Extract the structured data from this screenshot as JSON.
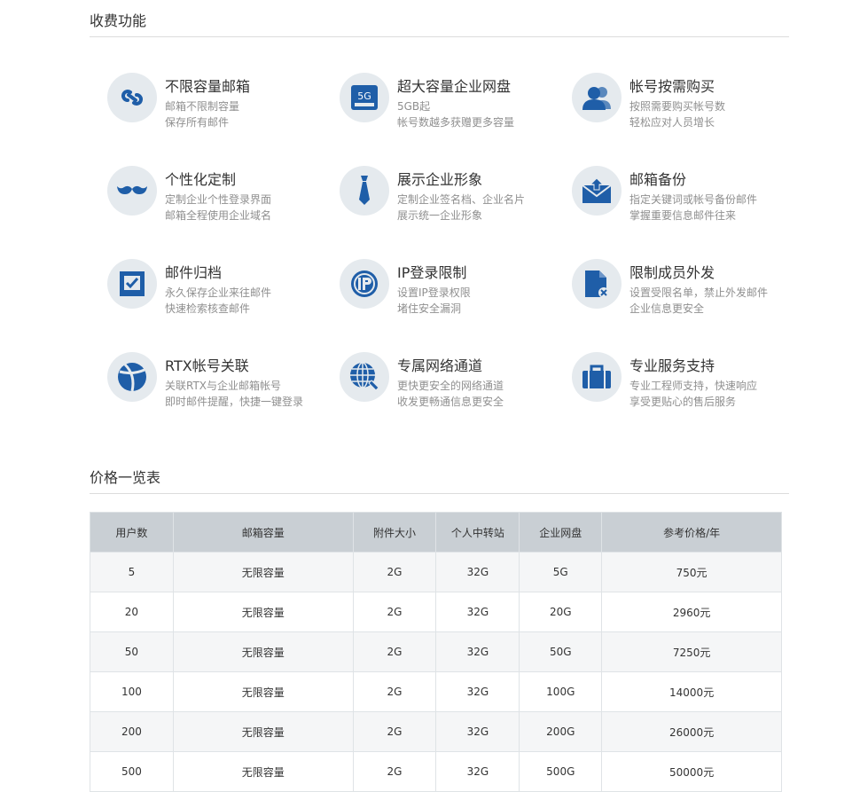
{
  "paid_features": {
    "title": "收费功能",
    "items": [
      {
        "title": "不限容量邮箱",
        "desc1": "邮箱不限制容量",
        "desc2": "保存所有邮件",
        "icon": "link-icon"
      },
      {
        "title": "超大容量企业网盘",
        "desc1": "5GB起",
        "desc2": "帐号数越多获赠更多容量",
        "icon": "drive-5g-icon",
        "icon_text": "5G"
      },
      {
        "title": "帐号按需购买",
        "desc1": "按照需要购买帐号数",
        "desc2": "轻松应对人员增长",
        "icon": "users-icon"
      },
      {
        "title": "个性化定制",
        "desc1": "定制企业个性登录界面",
        "desc2": "邮箱全程使用企业域名",
        "icon": "mustache-icon"
      },
      {
        "title": "展示企业形象",
        "desc1": "定制企业签名档、企业名片",
        "desc2": "展示统一企业形象",
        "icon": "tie-icon"
      },
      {
        "title": "邮箱备份",
        "desc1": "指定关键词或帐号备份邮件",
        "desc2": "掌握重要信息邮件往来",
        "icon": "mail-backup-icon"
      },
      {
        "title": "邮件归档",
        "desc1": "永久保存企业来往邮件",
        "desc2": "快速检索核查邮件",
        "icon": "archive-check-icon"
      },
      {
        "title": "IP登录限制",
        "desc1": "设置IP登录权限",
        "desc2": "堵住安全漏洞",
        "icon": "ip-restrict-icon"
      },
      {
        "title": "限制成员外发",
        "desc1": "设置受限名单，禁止外发邮件",
        "desc2": "企业信息更安全",
        "icon": "file-block-icon"
      },
      {
        "title": "RTX帐号关联",
        "desc1": "关联RTX与企业邮箱帐号",
        "desc2": "即时邮件提醒，快捷一键登录",
        "icon": "rtx-ball-icon"
      },
      {
        "title": "专属网络通道",
        "desc1": "更快更安全的网络通道",
        "desc2": "收发更畅通信息更安全",
        "icon": "globe-wrench-icon"
      },
      {
        "title": "专业服务支持",
        "desc1": "专业工程师支持，快速响应",
        "desc2": "享受更贴心的售后服务",
        "icon": "briefcase-icon"
      }
    ]
  },
  "price_list": {
    "title": "价格一览表",
    "headers": [
      "用户数",
      "邮箱容量",
      "附件大小",
      "个人中转站",
      "企业网盘",
      "参考价格/年"
    ],
    "rows": [
      [
        "5",
        "无限容量",
        "2G",
        "32G",
        "5G",
        "750元"
      ],
      [
        "20",
        "无限容量",
        "2G",
        "32G",
        "20G",
        "2960元"
      ],
      [
        "50",
        "无限容量",
        "2G",
        "32G",
        "50G",
        "7250元"
      ],
      [
        "100",
        "无限容量",
        "2G",
        "32G",
        "100G",
        "14000元"
      ],
      [
        "200",
        "无限容量",
        "2G",
        "32G",
        "200G",
        "26000元"
      ],
      [
        "500",
        "无限容量",
        "2G",
        "32G",
        "500G",
        "50000元"
      ]
    ]
  },
  "colors": {
    "icon_blue": "#1f5ea8",
    "icon_bg": "#e5eaee",
    "header_bg": "#c9cfd4"
  }
}
